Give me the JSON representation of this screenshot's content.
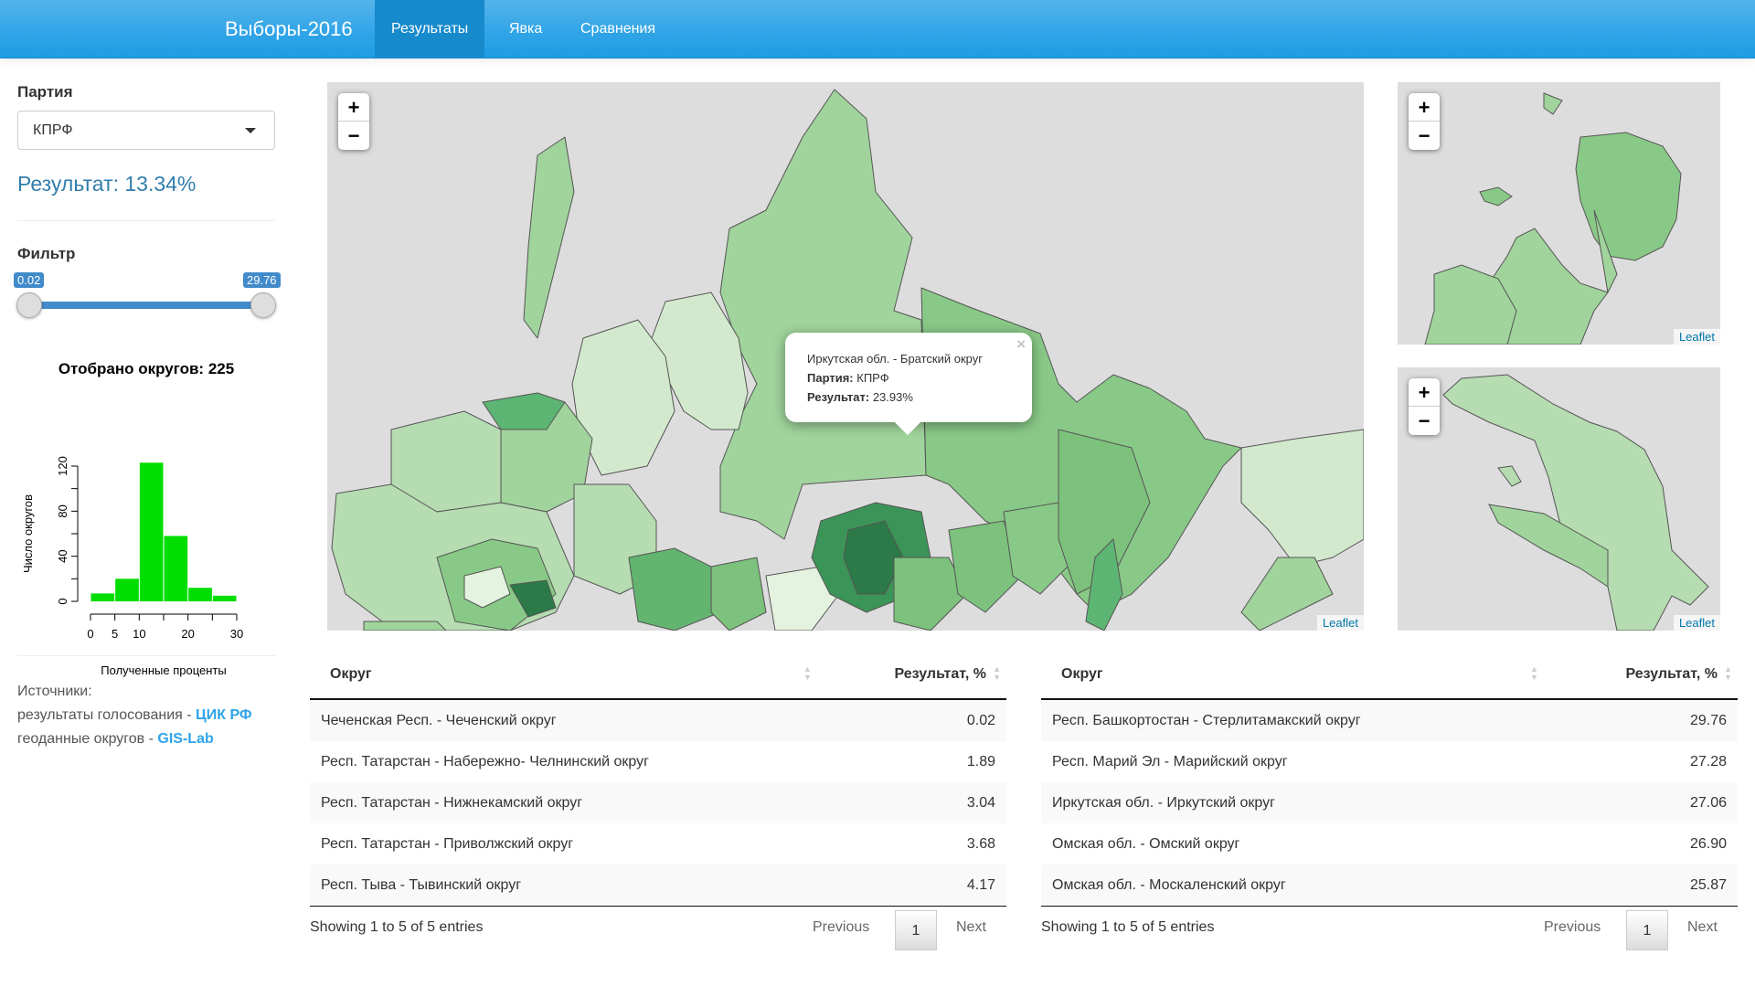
{
  "navbar": {
    "brand": "Выборы-2016",
    "tabs": [
      {
        "label": "Результаты",
        "active": true
      },
      {
        "label": "Явка",
        "active": false
      },
      {
        "label": "Сравнения",
        "active": false
      }
    ]
  },
  "sidebar": {
    "party_label": "Партия",
    "party_selected": "КПРФ",
    "result_text": "Результат: 13.34%",
    "filter_label": "Фильтр",
    "slider": {
      "min_value": "0.02",
      "max_value": "29.76",
      "range_min": 0.02,
      "range_max": 29.76
    },
    "sources": {
      "title": "Источники:",
      "line1_text": "результаты голосования - ",
      "line1_link": "ЦИК РФ",
      "line2_text": "геоданные округов - ",
      "line2_link": "GIS-Lab"
    }
  },
  "chart_data": {
    "type": "bar",
    "title": "Отобрано округов: 225",
    "xlabel": "Полученные проценты",
    "ylabel": "Число округов",
    "bins": [
      [
        0,
        5
      ],
      [
        5,
        10
      ],
      [
        10,
        15
      ],
      [
        15,
        20
      ],
      [
        20,
        25
      ],
      [
        25,
        30
      ]
    ],
    "values": [
      7,
      20,
      123,
      58,
      12,
      5
    ],
    "x_ticks": [
      "0",
      "5",
      "10",
      "20",
      "30"
    ],
    "x_tick_values": [
      0,
      5,
      10,
      20,
      30
    ],
    "y_ticks": [
      "0",
      "40",
      "80",
      "120"
    ],
    "y_tick_values": [
      0,
      40,
      80,
      120
    ],
    "xlim": [
      0,
      30
    ],
    "ylim": [
      0,
      120
    ],
    "bar_color": "#00dd00"
  },
  "map": {
    "zoom_in": "+",
    "zoom_out": "−",
    "attribution": "Leaflet",
    "popup": {
      "title": "Иркутская обл. - Братский округ",
      "party_label": "Партия:",
      "party_value": "КПРФ",
      "result_label": "Результат:",
      "result_value": "23.93%",
      "close": "×"
    }
  },
  "tables": [
    {
      "headers": [
        "Округ",
        "Результат, %"
      ],
      "rows": [
        [
          "Чеченская Респ. - Чеченский округ",
          "0.02"
        ],
        [
          "Респ. Татарстан - Набережно- Челнинский округ",
          "1.89"
        ],
        [
          "Респ. Татарстан - Нижнекамский округ",
          "3.04"
        ],
        [
          "Респ. Татарстан - Приволжский округ",
          "3.68"
        ],
        [
          "Респ. Тыва - Тывинский округ",
          "4.17"
        ]
      ],
      "info": "Showing 1 to 5 of 5 entries",
      "prev": "Previous",
      "page": "1",
      "next": "Next"
    },
    {
      "headers": [
        "Округ",
        "Результат, %"
      ],
      "rows": [
        [
          "Респ. Башкортостан - Стерлитамакский округ",
          "29.76"
        ],
        [
          "Респ. Марий Эл - Марийский округ",
          "27.28"
        ],
        [
          "Иркутская обл. - Иркутский округ",
          "27.06"
        ],
        [
          "Омская обл. - Омский округ",
          "26.90"
        ],
        [
          "Омская обл. - Москаленский округ",
          "25.87"
        ]
      ],
      "info": "Showing 1 to 5 of 5 entries",
      "prev": "Previous",
      "page": "1",
      "next": "Next"
    }
  ]
}
